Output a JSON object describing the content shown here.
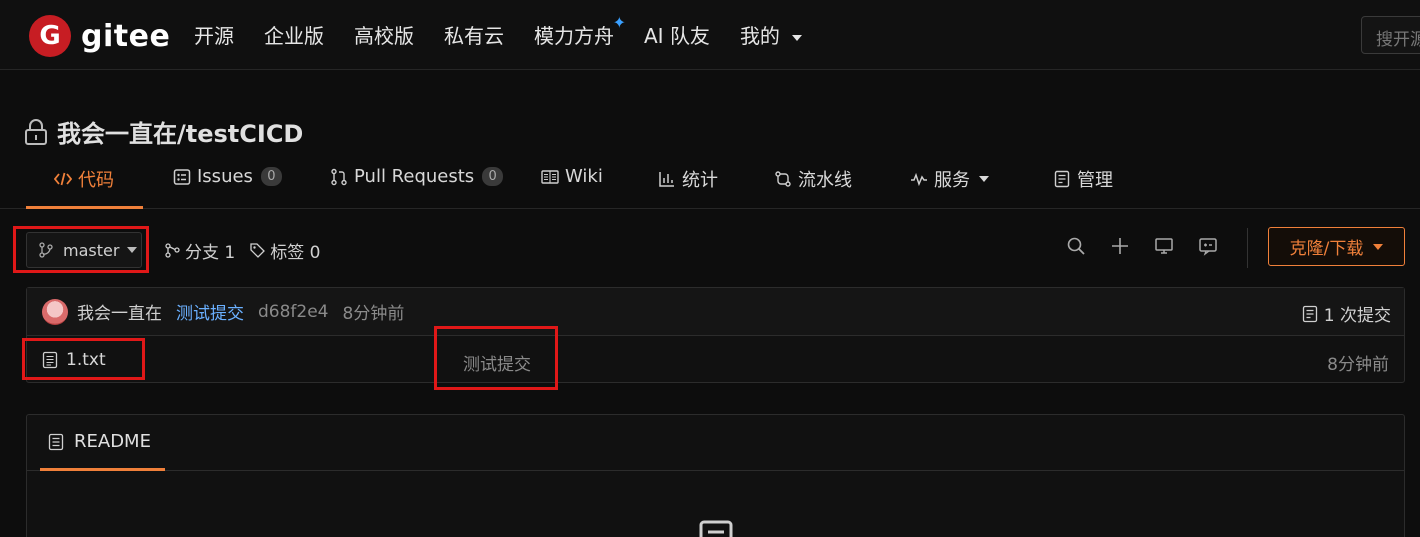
{
  "brand": {
    "logo_letter": "G",
    "name": "gitee"
  },
  "topnav": {
    "items": [
      "开源",
      "企业版",
      "高校版",
      "私有云",
      "模力方舟",
      "AI 队友",
      "我的"
    ],
    "sparkle": "✦",
    "search_placeholder": "搜开源"
  },
  "repo": {
    "title": "我会一直在/testCICD"
  },
  "tabs": [
    {
      "label": "代码",
      "icon": "code-icon"
    },
    {
      "label": "Issues",
      "count": "0",
      "icon": "issues-icon"
    },
    {
      "label": "Pull Requests",
      "count": "0",
      "icon": "pull-request-icon"
    },
    {
      "label": "Wiki",
      "icon": "book-icon"
    },
    {
      "label": "统计",
      "icon": "bar-chart-icon"
    },
    {
      "label": "流水线",
      "icon": "pipeline-icon"
    },
    {
      "label": "服务",
      "icon": "pulse-icon"
    },
    {
      "label": "管理",
      "icon": "settings-doc-icon"
    }
  ],
  "branch_bar": {
    "branch": "master",
    "branches_label": "分支 1",
    "tags_label": "标签 0",
    "clone_label": "克隆/下载"
  },
  "commit": {
    "author": "我会一直在",
    "message": "测试提交",
    "hash": "d68f2e4",
    "time": "8分钟前",
    "count_label": "1 次提交"
  },
  "files": [
    {
      "name": "1.txt",
      "message": "测试提交",
      "time": "8分钟前"
    }
  ],
  "readme": {
    "tab_label": "README"
  },
  "colors": {
    "accent": "#f0803a",
    "brand_red": "#c71d23",
    "link_blue": "#6ab0ff",
    "highlight_red": "#e01818"
  }
}
